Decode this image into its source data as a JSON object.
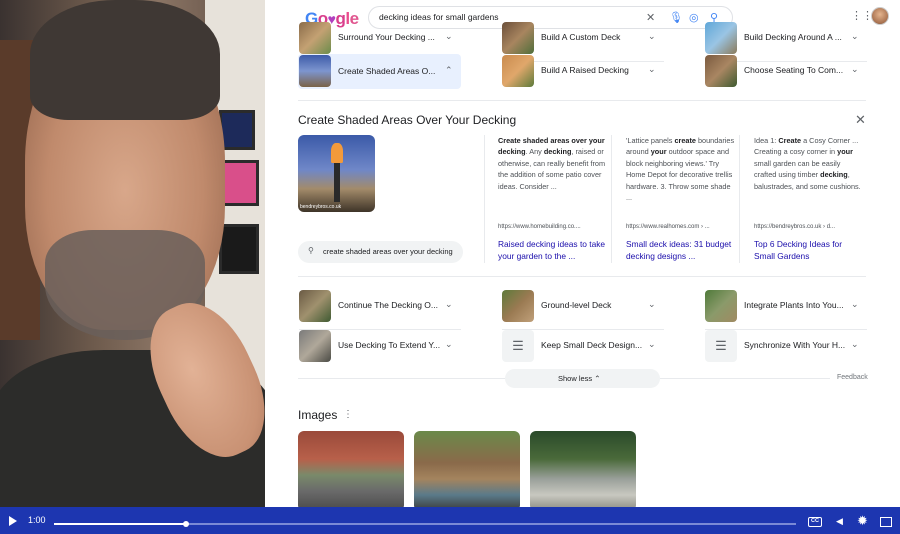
{
  "search": {
    "query": "decking ideas for small gardens",
    "logo_text": "Google"
  },
  "paa_top": [
    {
      "label": "Surround Your Decking ...",
      "col": 0
    },
    {
      "label": "Build A Custom Deck",
      "col": 1
    },
    {
      "label": "Build Decking Around A ...",
      "col": 2
    }
  ],
  "paa_row1": [
    {
      "label": "Create Shaded Areas O...",
      "expanded": true
    },
    {
      "label": "Build A Raised Decking",
      "expanded": false
    },
    {
      "label": "Choose Seating To Com...",
      "expanded": false
    }
  ],
  "expanded": {
    "title": "Create Shaded Areas Over Your Decking",
    "image_caption": "bendreybros.co.uk",
    "related_search": "create shaded areas over your decking",
    "snippets": [
      {
        "text_html": "<b>Create shaded areas over your decking</b>. Any <b>decking</b>, raised or otherwise, can really benefit from the addition of some patio cover ideas. Consider ...",
        "source": "https://www.homebuilding.co....",
        "link": "Raised decking ideas to take your garden to the ..."
      },
      {
        "text_html": "'Lattice panels <b>create</b> boundaries around <b>your</b> outdoor space and block neighboring views.' Try Home Depot for decorative trellis hardware. 3. Throw some shade ...",
        "source": "https://www.realhomes.com › ...",
        "link": "Small deck ideas: 31 budget decking designs ..."
      },
      {
        "text_html": "Idea 1: <b>Create</b> a Cosy Corner ... Creating a cosy corner in <b>your</b> small garden can be easily crafted using timber <b>decking</b>, balustrades, and some cushions.",
        "source": "https://bendreybros.co.uk › d...",
        "link": "Top 6 Decking Ideas for Small Gardens"
      }
    ]
  },
  "paa_row2": [
    {
      "label": "Continue The Decking O...",
      "thumb": "photo"
    },
    {
      "label": "Ground-level Deck",
      "thumb": "photo"
    },
    {
      "label": "Integrate Plants Into You...",
      "thumb": "photo"
    }
  ],
  "paa_row3": [
    {
      "label": "Use Decking To Extend Y...",
      "thumb": "photo"
    },
    {
      "label": "Keep Small Deck Design...",
      "thumb": "doc"
    },
    {
      "label": "Synchronize With Your H...",
      "thumb": "doc"
    }
  ],
  "show_less_label": "Show less",
  "feedback_label": "Feedback",
  "images_title": "Images",
  "player": {
    "time": "1:00",
    "progress_fraction": 0.178,
    "cc_label": "CC"
  },
  "colors": {
    "player_bar": "#1d36b0",
    "link": "#1a0dab",
    "active_chip": "#e8f0fe"
  }
}
